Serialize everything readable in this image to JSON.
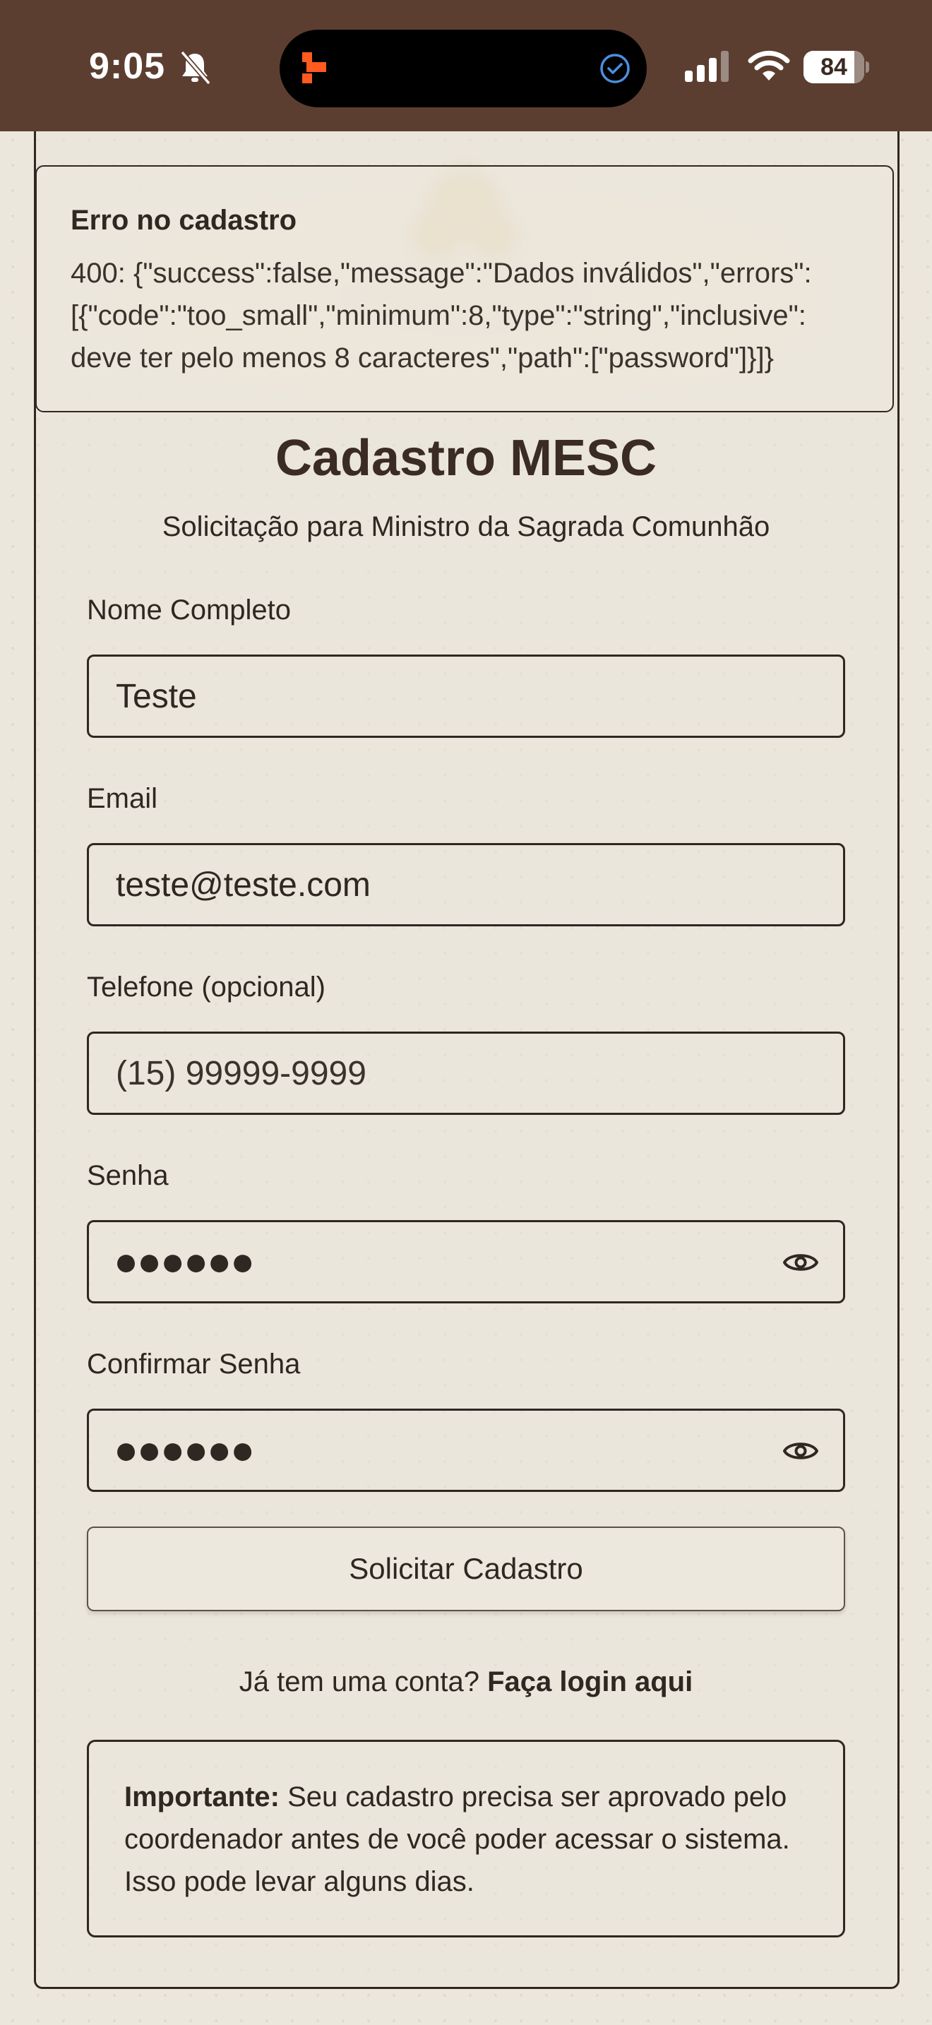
{
  "status_bar": {
    "time": "9:05",
    "battery": "84",
    "battery_level_percent": 84,
    "icons": [
      "bell-slash-icon",
      "app-activity-icon",
      "check-circle-icon",
      "cellular-signal-icon",
      "wifi-icon",
      "battery-icon"
    ]
  },
  "toast": {
    "title": "Erro no cadastro",
    "message": "400: {\"success\":false,\"message\":\"Dados inválidos\",\"errors\":\n[{\"code\":\"too_small\",\"minimum\":8,\"type\":\"string\",\"inclusive\":\ndeve ter pelo menos 8 caracteres\",\"path\":[\"password\"]}]}"
  },
  "form": {
    "title": "Cadastro MESC",
    "subtitle": "Solicitação para Ministro da Sagrada Comunhão",
    "name_label": "Nome Completo",
    "name_value": "Teste",
    "email_label": "Email",
    "email_value": "teste@teste.com",
    "phone_label": "Telefone (opcional)",
    "phone_placeholder": "(15) 99999-9999",
    "password_label": "Senha",
    "password_masked": "●●●●●●",
    "confirm_label": "Confirmar Senha",
    "confirm_masked": "●●●●●●",
    "submit_label": "Solicitar Cadastro",
    "login_prompt": "Já tem uma conta?",
    "login_link": "Faça login aqui"
  },
  "notice": {
    "bold": "Importante:",
    "text": " Seu cadastro precisa ser aprovado pelo coordenador antes de você poder acessar o sistema. Isso pode levar alguns dias."
  },
  "colors": {
    "status_bar": "#5c3e31",
    "background": "#ece7dc",
    "text": "#2e2722",
    "accent_orange": "#ff5a1f"
  }
}
